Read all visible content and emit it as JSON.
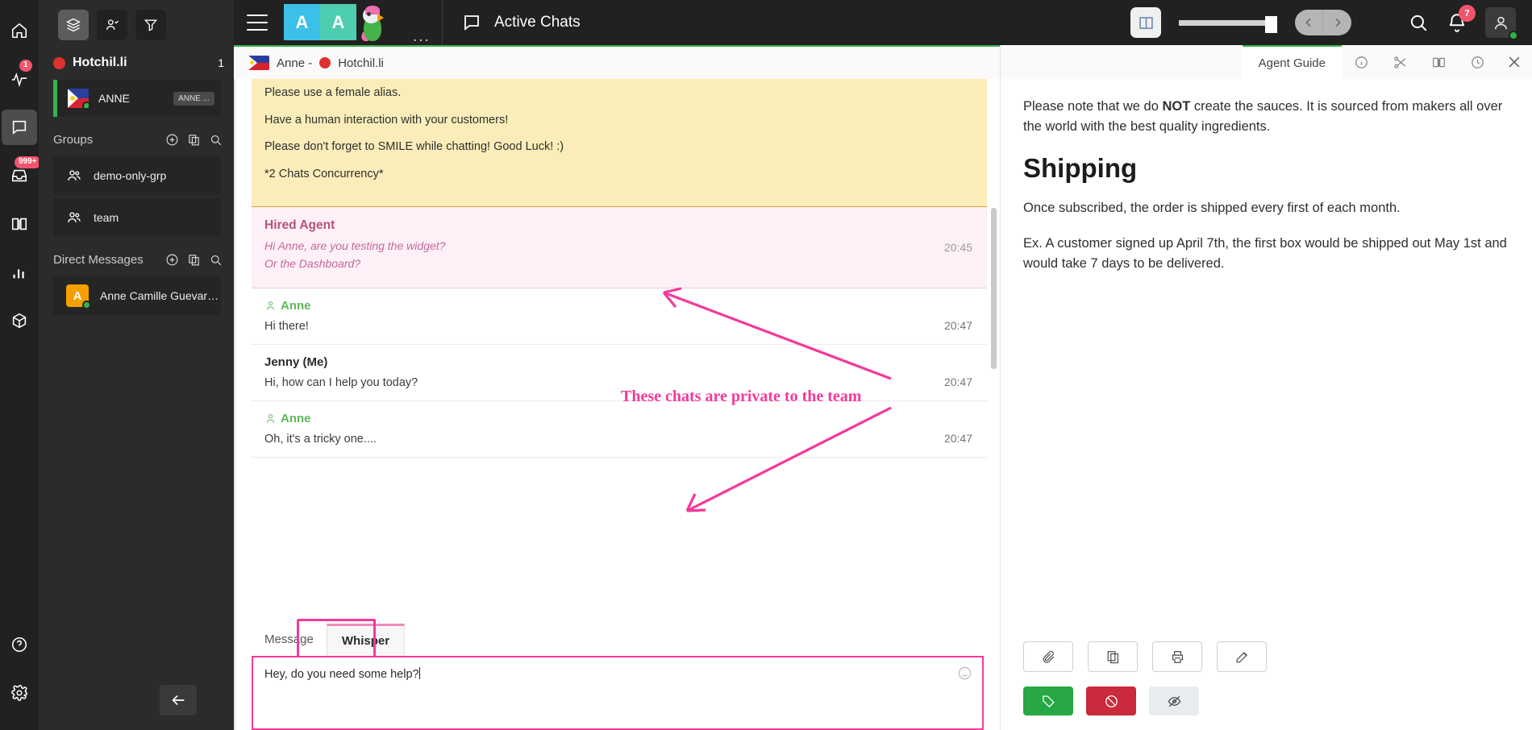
{
  "rail": {
    "items": [
      {
        "name": "home",
        "icon": "home-icon",
        "badge": null,
        "active": false
      },
      {
        "name": "activity",
        "icon": "pulse-icon",
        "badge": "1",
        "active": false
      },
      {
        "name": "chats",
        "icon": "chat-bubble-icon",
        "badge": null,
        "active": true
      },
      {
        "name": "inbox",
        "icon": "inbox-icon",
        "badge": "999+",
        "active": false
      },
      {
        "name": "knowledge",
        "icon": "book-icon",
        "badge": null,
        "active": false
      },
      {
        "name": "reports",
        "icon": "bar-chart-icon",
        "badge": null,
        "active": false
      },
      {
        "name": "integrations",
        "icon": "cube-icon",
        "badge": null,
        "active": false
      }
    ],
    "bottom": [
      {
        "name": "help",
        "icon": "question-circle-icon"
      },
      {
        "name": "settings",
        "icon": "gear-icon"
      }
    ]
  },
  "sidebar": {
    "tools": [
      {
        "name": "queues",
        "icon": "layers-icon",
        "active": true
      },
      {
        "name": "assigned",
        "icon": "user-check-icon",
        "active": false
      },
      {
        "name": "filter",
        "icon": "funnel-icon",
        "active": false
      }
    ],
    "group_header": {
      "title": "Hotchil.li",
      "count": "1",
      "status_color": "#e03131"
    },
    "active_chat": {
      "name": "ANNE",
      "tag": "ANNE ...",
      "flag": "ph-flag-icon",
      "online": true
    },
    "groups_label": "Groups",
    "groups": [
      {
        "label": "demo-only-grp",
        "icon": "users-icon"
      },
      {
        "label": "team",
        "icon": "users-icon"
      }
    ],
    "dm_label": "Direct Messages",
    "dms": [
      {
        "label": "Anne Camille Guevarra (...",
        "initial": "A",
        "color": "#f59f00",
        "online": true
      }
    ],
    "section_actions": [
      "plus-circle-icon",
      "copy-icon",
      "search-icon"
    ],
    "collapse_icon": "arrow-left-icon"
  },
  "topbar": {
    "menu_icon": "hamburger-icon",
    "avatars": [
      {
        "label": "A",
        "color": "#3bc0e8"
      },
      {
        "label": "A",
        "color": "#4ecdb0"
      }
    ],
    "parrot_icon": "parrot-avatar-icon",
    "more_dots": "...",
    "section_icon": "chat-bubble-icon",
    "section_title": "Active Chats",
    "split_view_icon": "split-pane-icon",
    "slider_value": 100,
    "pager_prev_icon": "chevron-left-icon",
    "pager_next_icon": "chevron-right-icon",
    "search_icon": "search-icon",
    "bell_icon": "bell-icon",
    "bell_badge": "7",
    "profile_icon": "user-avatar-icon"
  },
  "chat": {
    "tab_label": "Anne -",
    "tab_brand": "Hotchil.li",
    "tab_flag_icon": "ph-flag-icon",
    "briefing": [
      "Please use a female alias.",
      "Have a human interaction with your customers!",
      "Please don't forget to SMILE while chatting! Good Luck! :)",
      "*2 Chats Concurrency*"
    ],
    "whisper_block": {
      "author": "Hired Agent",
      "lines": [
        "Hi Anne, are you testing the widget?",
        "Or the Dashboard?"
      ],
      "time": "20:45"
    },
    "messages": [
      {
        "author": "Anne",
        "is_customer": true,
        "body": "Hi there!",
        "time": "20:47"
      },
      {
        "author": "Jenny (Me)",
        "is_customer": false,
        "body": "Hi, how can I help you today?",
        "time": "20:47"
      },
      {
        "author": "Anne",
        "is_customer": true,
        "body": "Oh, it's a tricky one....",
        "time": "20:47"
      }
    ],
    "composer": {
      "tabs": [
        {
          "label": "Message",
          "selected": false
        },
        {
          "label": "Whisper",
          "selected": true
        }
      ],
      "value": "Hey, do you need some help?",
      "emoji_icon": "smiley-icon"
    }
  },
  "rightpanel": {
    "tab_label": "Agent Guide",
    "tab_icons": [
      "info-circle-icon",
      "scissors-icon",
      "book-icon",
      "clock-icon"
    ],
    "close_icon": "close-icon",
    "intro_before": "Please note that we do ",
    "intro_bold": "NOT",
    "intro_after": " create the sauces. It is sourced from makers all over the world with the best quality ingredients.",
    "heading": "Shipping",
    "paragraphs": [
      "Once subscribed, the order is shipped every first of each month.",
      "Ex. A customer signed up April 7th, the first box would be shipped out May 1st and would take 7 days to be delivered."
    ],
    "actions_row1": [
      "paperclip-icon",
      "duplicate-icon",
      "printer-icon",
      "edit-icon"
    ],
    "actions_row2": [
      {
        "icon": "tag-icon",
        "color": "#28a745"
      },
      {
        "icon": "ban-icon",
        "color": "#c92a3c"
      },
      {
        "icon": "eye-off-icon",
        "color": "#e9ecef"
      }
    ]
  },
  "annotation": {
    "text": "These chats are private to the team",
    "color": "#f5399a"
  }
}
